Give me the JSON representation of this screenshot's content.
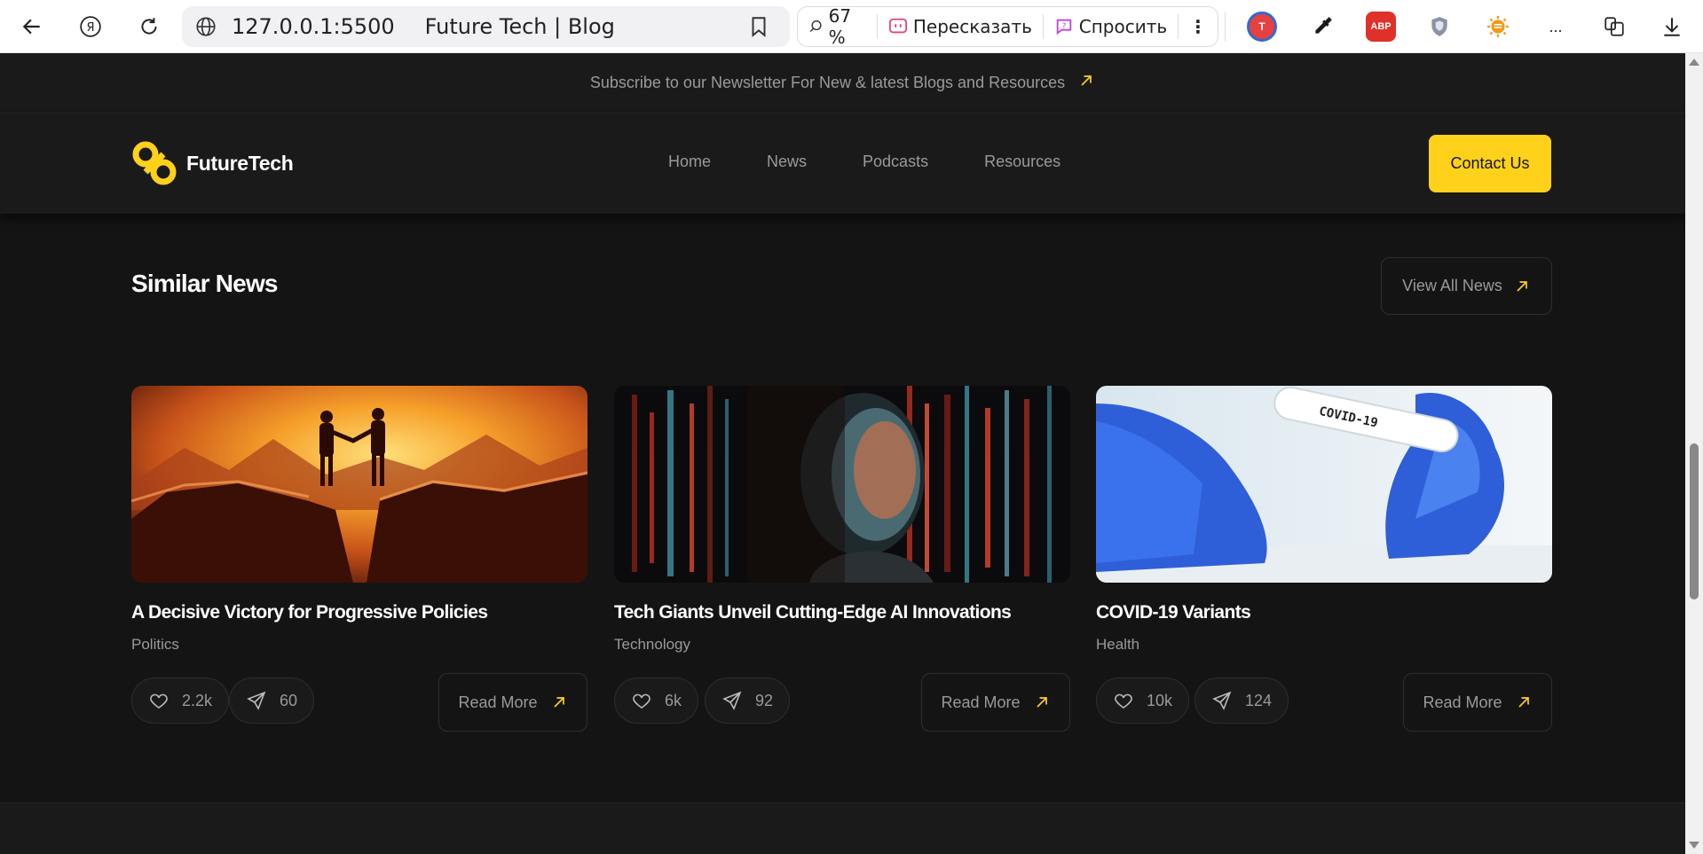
{
  "browser": {
    "url": "127.0.0.1:5500",
    "tab_title": "Future Tech | Blog",
    "zoom": "67 %",
    "retell_label": "Пересказать",
    "ask_label": "Спросить",
    "more_label": "...",
    "abp_label": "ABP"
  },
  "topbar": {
    "text": "Subscribe to our Newsletter For New & latest Blogs and Resources"
  },
  "header": {
    "logo_text": "FutureTech",
    "nav": [
      "Home",
      "News",
      "Podcasts",
      "Resources"
    ],
    "contact_label": "Contact Us"
  },
  "section": {
    "title": "Similar News",
    "view_all_label": "View All News"
  },
  "cards": [
    {
      "title": "A Decisive Victory for Progressive Policies",
      "category": "Politics",
      "likes": "2.2k",
      "shares": "60",
      "read_more": "Read More"
    },
    {
      "title": "Tech Giants Unveil Cutting-Edge AI Innovations",
      "category": "Technology",
      "likes": "6k",
      "shares": "92",
      "read_more": "Read More"
    },
    {
      "title": "COVID-19 Variants",
      "category": "Health",
      "likes": "10k",
      "shares": "124",
      "read_more": "Read More",
      "image_label": "COVID-19"
    }
  ],
  "colors": {
    "accent": "#ffd11a",
    "background": "#141414",
    "surface": "#1a1a1a",
    "muted_text": "#9a9a9a"
  }
}
